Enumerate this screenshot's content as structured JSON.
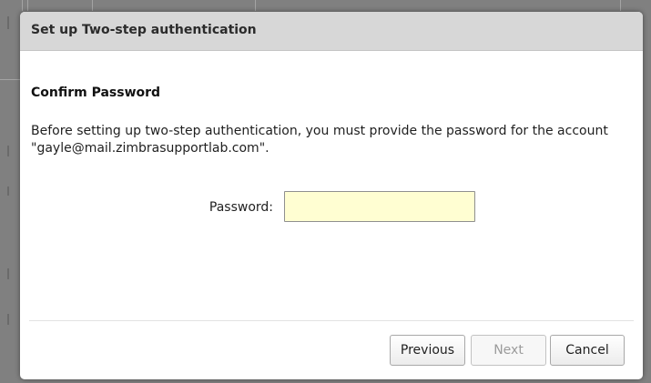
{
  "dialog": {
    "title": "Set up Two-step authentication",
    "section_title": "Confirm Password",
    "description": "Before setting up two-step authentication, you must provide the password for the account \"gayle@mail.zimbrasupportlab.com\".",
    "password_label": "Password:",
    "password_value": "",
    "buttons": {
      "previous": "Previous",
      "next": "Next",
      "cancel": "Cancel"
    }
  },
  "colors": {
    "header_bg": "#d7d7d7",
    "input_bg": "#fffed2",
    "disabled_text": "#9b9b9b"
  }
}
